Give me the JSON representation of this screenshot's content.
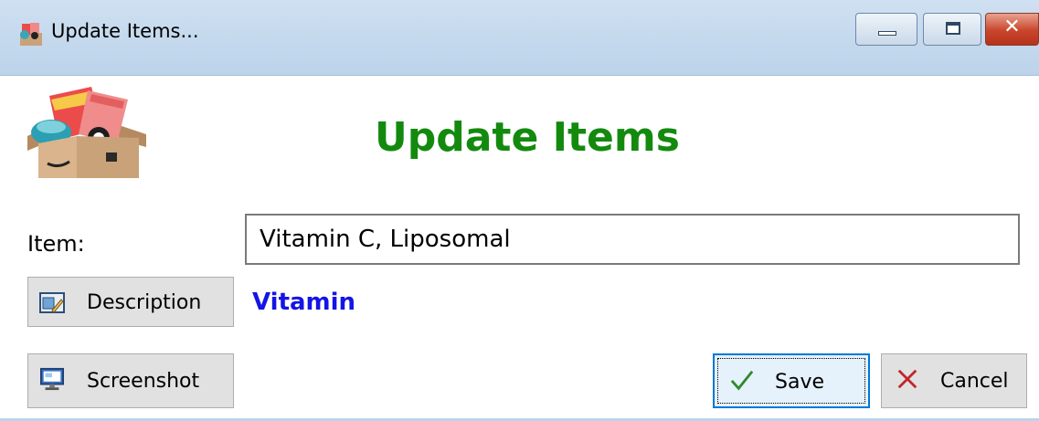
{
  "window": {
    "title": "Update Items...",
    "icon": "boxed-products-app-icon",
    "controls": {
      "minimize": "minimize-icon",
      "maximize": "maximize-icon",
      "close": "✕"
    }
  },
  "header": {
    "logo": "boxed-products-logo",
    "title": "Update Items",
    "title_color": "#138a0e"
  },
  "form": {
    "item_label": "Item:",
    "item_value": "Vitamin C, Liposomal",
    "category_text": "Vitamin",
    "category_color": "#1414e6"
  },
  "buttons": {
    "description": {
      "label": "Description",
      "icon": "description-edit-icon"
    },
    "screenshot": {
      "label": "Screenshot",
      "icon": "monitor-icon"
    },
    "save": {
      "label": "Save",
      "icon": "checkmark-icon"
    },
    "cancel": {
      "label": "Cancel",
      "icon": "x-icon"
    }
  }
}
